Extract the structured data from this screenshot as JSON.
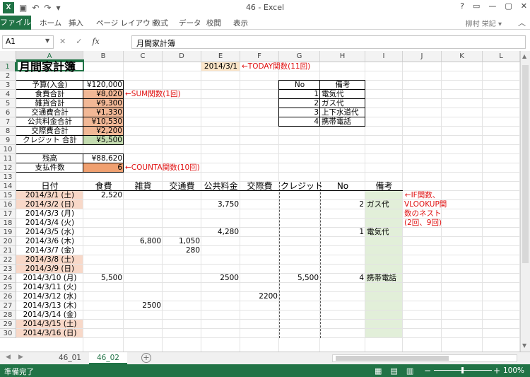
{
  "window": {
    "title": "46 - Excel",
    "controls": [
      "?",
      "▭",
      "—",
      "▢",
      "✕"
    ]
  },
  "ribbon": {
    "file": "ファイル",
    "tabs": [
      "ホーム",
      "挿入",
      "ページ レイアウト",
      "数式",
      "データ",
      "校閲",
      "表示"
    ],
    "account": "柳村 栄記 ▾"
  },
  "formula_bar": {
    "name_box": "A1",
    "cancel": "✕",
    "enter": "✓",
    "fx": "fx",
    "content": "月間家計簿"
  },
  "columns": [
    "A",
    "B",
    "C",
    "D",
    "E",
    "F",
    "G",
    "H",
    "I",
    "J",
    "K",
    "L"
  ],
  "rows": [
    "1",
    "2",
    "3",
    "4",
    "5",
    "6",
    "7",
    "8",
    "9",
    "10",
    "11",
    "12",
    "13",
    "14",
    "15",
    "16",
    "17",
    "18",
    "19",
    "20",
    "21",
    "22",
    "23",
    "24",
    "25",
    "26",
    "27",
    "28",
    "29",
    "30"
  ],
  "title": "月間家計簿",
  "today": "2014/3/1",
  "note_today": "←TODAY関数(11回)",
  "summary": [
    {
      "label": "予算(入金)",
      "value": "¥120,000"
    },
    {
      "label": "食費合計",
      "value": "¥8,020"
    },
    {
      "label": "雑貨合計",
      "value": "¥9,300"
    },
    {
      "label": "交通費合計",
      "value": "¥1,330"
    },
    {
      "label": "公共料金合計",
      "value": "¥10,530"
    },
    {
      "label": "交際費合計",
      "value": "¥2,200"
    },
    {
      "label": "クレジット 合計",
      "value": "¥5,500"
    }
  ],
  "note_sum": "←SUM関数(1回)",
  "balance": {
    "label": "残高",
    "value": "¥88,620"
  },
  "payments": {
    "label": "支払件数",
    "value": "6"
  },
  "note_counta": "←COUNTA関数(10回)",
  "lookup": {
    "headers": [
      "No",
      "備考"
    ],
    "rows": [
      {
        "no": "1",
        "note": "電気代"
      },
      {
        "no": "2",
        "note": "ガス代"
      },
      {
        "no": "3",
        "note": "上下水道代"
      },
      {
        "no": "4",
        "note": "携帯電話"
      }
    ]
  },
  "ledger_headers": [
    "日付",
    "食費",
    "雑貨",
    "交通費",
    "公共料金",
    "交際費",
    "クレジット",
    "No",
    "備考"
  ],
  "ledger": [
    {
      "date": "2014/3/1 (土)",
      "food": "2,520",
      "goods": "",
      "transport": "",
      "utility": "",
      "social": "",
      "credit": "",
      "no": "",
      "note": "",
      "wk": true
    },
    {
      "date": "2014/3/2 (日)",
      "food": "",
      "goods": "",
      "transport": "",
      "utility": "3,750",
      "social": "",
      "credit": "",
      "no": "2",
      "note": "ガス代",
      "wk": true
    },
    {
      "date": "2014/3/3 (月)",
      "food": "",
      "goods": "",
      "transport": "",
      "utility": "",
      "social": "",
      "credit": "",
      "no": "",
      "note": "",
      "wk": false
    },
    {
      "date": "2014/3/4 (火)",
      "food": "",
      "goods": "",
      "transport": "",
      "utility": "",
      "social": "",
      "credit": "",
      "no": "",
      "note": "",
      "wk": false
    },
    {
      "date": "2014/3/5 (水)",
      "food": "",
      "goods": "",
      "transport": "",
      "utility": "4,280",
      "social": "",
      "credit": "",
      "no": "1",
      "note": "電気代",
      "wk": false
    },
    {
      "date": "2014/3/6 (木)",
      "food": "",
      "goods": "6,800",
      "transport": "1,050",
      "utility": "",
      "social": "",
      "credit": "",
      "no": "",
      "note": "",
      "wk": false
    },
    {
      "date": "2014/3/7 (金)",
      "food": "",
      "goods": "",
      "transport": "280",
      "utility": "",
      "social": "",
      "credit": "",
      "no": "",
      "note": "",
      "wk": false
    },
    {
      "date": "2014/3/8 (土)",
      "food": "",
      "goods": "",
      "transport": "",
      "utility": "",
      "social": "",
      "credit": "",
      "no": "",
      "note": "",
      "wk": true
    },
    {
      "date": "2014/3/9 (日)",
      "food": "",
      "goods": "",
      "transport": "",
      "utility": "",
      "social": "",
      "credit": "",
      "no": "",
      "note": "",
      "wk": true
    },
    {
      "date": "2014/3/10 (月)",
      "food": "5,500",
      "goods": "",
      "transport": "",
      "utility": "2500",
      "social": "",
      "credit": "5,500",
      "no": "4",
      "note": "携帯電話",
      "wk": false
    },
    {
      "date": "2014/3/11 (火)",
      "food": "",
      "goods": "",
      "transport": "",
      "utility": "",
      "social": "",
      "credit": "",
      "no": "",
      "note": "",
      "wk": false
    },
    {
      "date": "2014/3/12 (水)",
      "food": "",
      "goods": "",
      "transport": "",
      "utility": "",
      "social": "2200",
      "credit": "",
      "no": "",
      "note": "",
      "wk": false
    },
    {
      "date": "2014/3/13 (木)",
      "food": "",
      "goods": "2500",
      "transport": "",
      "utility": "",
      "social": "",
      "credit": "",
      "no": "",
      "note": "",
      "wk": false
    },
    {
      "date": "2014/3/14 (金)",
      "food": "",
      "goods": "",
      "transport": "",
      "utility": "",
      "social": "",
      "credit": "",
      "no": "",
      "note": "",
      "wk": false
    },
    {
      "date": "2014/3/15 (土)",
      "food": "",
      "goods": "",
      "transport": "",
      "utility": "",
      "social": "",
      "credit": "",
      "no": "",
      "note": "",
      "wk": true
    },
    {
      "date": "2014/3/16 (日)",
      "food": "",
      "goods": "",
      "transport": "",
      "utility": "",
      "social": "",
      "credit": "",
      "no": "",
      "note": "",
      "wk": true
    }
  ],
  "note_if": [
    "←IF関数、",
    "VLOOKUP関",
    "数のネスト",
    "(2回、9回)"
  ],
  "sheets": [
    "46_01",
    "46_02"
  ],
  "status": "準備完了",
  "zoom": "100%",
  "colors": {
    "excel_green": "#217346",
    "weekend": "#f8d8c8",
    "today": "#fbe5c8",
    "salmon": "#f2b896",
    "counta": "#f0a070",
    "credit_green": "#c4dcb0",
    "note_green": "#e2efd9",
    "red": "#e01010"
  }
}
